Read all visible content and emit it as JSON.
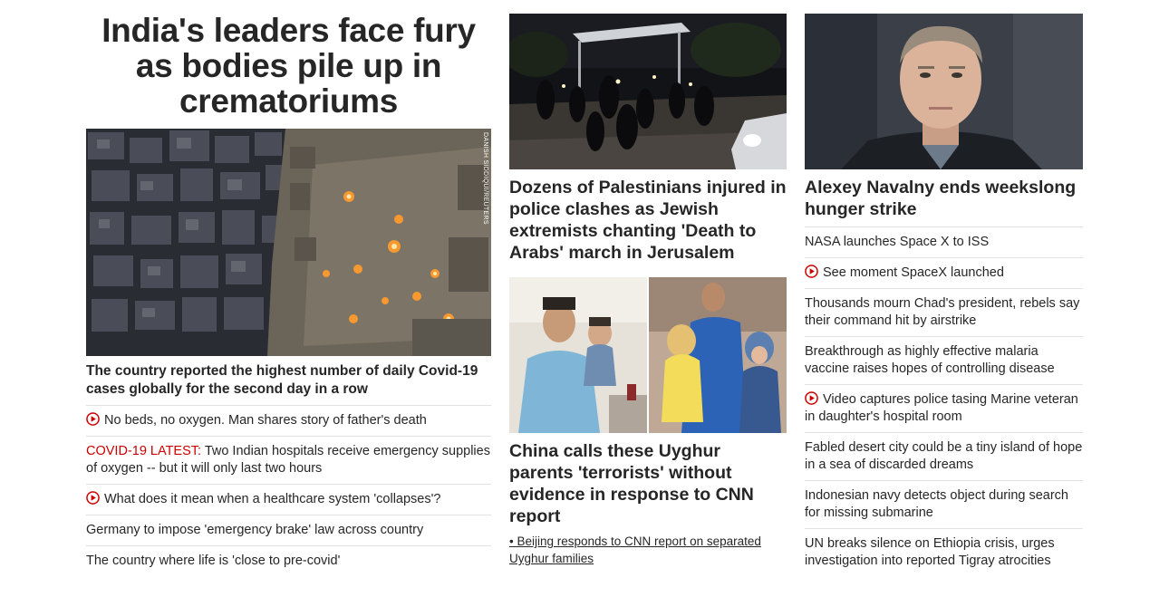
{
  "left": {
    "headline": "India's leaders face fury as bodies pile up in crematoriums",
    "photo_credit": "DANISH SIDDIQUI/REUTERS",
    "subheadline": "The country reported the highest number of daily Covid-19 cases globally for the second day in a row",
    "links": [
      {
        "prefix": "",
        "text": "No beds, no oxygen. Man shares story of father's death",
        "video": true
      },
      {
        "prefix": "COVID-19 LATEST:",
        "text": " Two Indian hospitals receive emergency supplies of oxygen -- but it will only last two hours",
        "video": false
      },
      {
        "prefix": "",
        "text": "What does it mean when a healthcare system 'collapses'?",
        "video": true
      },
      {
        "prefix": "",
        "text": "Germany to impose 'emergency brake' law across country",
        "video": false
      },
      {
        "prefix": "",
        "text": "The country where life is 'close to pre-covid'",
        "video": false
      }
    ]
  },
  "middle": {
    "story1_headline": "Dozens of Palestinians injured in police clashes as Jewish extremists chanting 'Death to Arabs' march in Jerusalem",
    "story2_headline": "China calls these Uyghur parents 'terrorists' without evidence in response to CNN report",
    "story2_link": "• Beijing responds to CNN report on separated Uyghur families"
  },
  "right": {
    "headline": "Alexey Navalny ends weekslong hunger strike",
    "links": [
      {
        "text": "NASA launches Space X to ISS",
        "video": false
      },
      {
        "text": "See moment SpaceX launched",
        "video": true
      },
      {
        "text": "Thousands mourn Chad's president, rebels say their command hit by airstrike",
        "video": false
      },
      {
        "text": "Breakthrough as highly effective malaria vaccine raises hopes of controlling disease",
        "video": false
      },
      {
        "text": "Video captures police tasing Marine veteran in daughter's hospital room",
        "video": true
      },
      {
        "text": "Fabled desert city could be a tiny island of hope in a sea of discarded dreams",
        "video": false
      },
      {
        "text": "Indonesian navy detects object during search for missing submarine",
        "video": false
      },
      {
        "text": "UN breaks silence on Ethiopia crisis, urges investigation into reported Tigray atrocities",
        "video": false
      }
    ]
  },
  "colors": {
    "accent_red": "#cc0000",
    "text": "#262626",
    "divider": "#e2e2e2"
  }
}
